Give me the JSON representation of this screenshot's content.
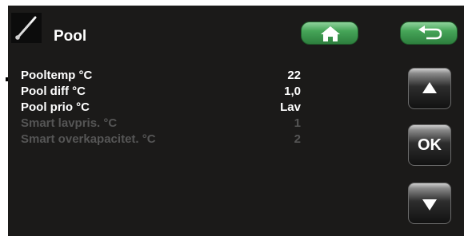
{
  "header": {
    "title": "Pool",
    "icon": "thermometer-probe-icon",
    "home_icon": "home-icon",
    "back_icon": "return-arrow-icon",
    "accent": "#46a558"
  },
  "menu": {
    "items": [
      {
        "label": "Pooltemp °C",
        "value": "22",
        "enabled": true
      },
      {
        "label": "Pool diff °C",
        "value": "1,0",
        "enabled": true
      },
      {
        "label": "Pool prio °C",
        "value": "Lav",
        "enabled": true
      },
      {
        "label": "Smart lavpris. °C",
        "value": "1",
        "enabled": false
      },
      {
        "label": "Smart overkapacitet. °C",
        "value": "2",
        "enabled": false
      }
    ]
  },
  "controls": {
    "up_icon": "arrow-up-icon",
    "ok_label": "OK",
    "down_icon": "arrow-down-icon"
  }
}
